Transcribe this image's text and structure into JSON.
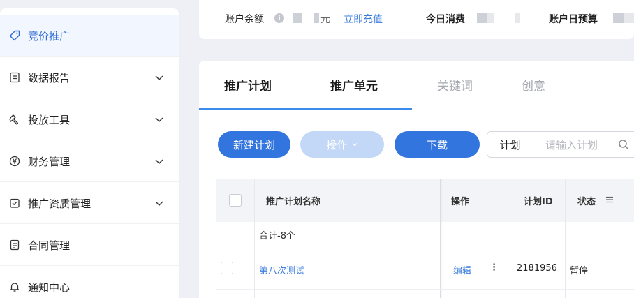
{
  "sidebar": {
    "items": [
      {
        "label": "竞价推广",
        "icon": "tag-icon",
        "expandable": false,
        "active": true
      },
      {
        "label": "数据报告",
        "icon": "report-icon",
        "expandable": true
      },
      {
        "label": "投放工具",
        "icon": "tools-icon",
        "expandable": true
      },
      {
        "label": "财务管理",
        "icon": "yuan-icon",
        "expandable": true
      },
      {
        "label": "推广资质管理",
        "icon": "certificate-icon",
        "expandable": true
      },
      {
        "label": "合同管理",
        "icon": "contract-icon",
        "expandable": false
      },
      {
        "label": "通知中心",
        "icon": "bell-icon",
        "expandable": false
      }
    ]
  },
  "topbar": {
    "balance_label": "账户余额",
    "balance_unit": "元",
    "recharge_link": "立即充值",
    "today_spend_label": "今日消费",
    "daily_budget_label": "账户日预算"
  },
  "tabs": [
    {
      "label": "推广计划",
      "active": true
    },
    {
      "label": "推广单元",
      "active": false
    },
    {
      "label": "关键词",
      "active": false
    },
    {
      "label": "创意",
      "active": false
    }
  ],
  "toolbar": {
    "new_plan": "新建计划",
    "operate": "操作",
    "download": "下载",
    "filter_select": "计划",
    "search_placeholder": "请输入计划"
  },
  "table": {
    "columns": [
      "推广计划名称",
      "操作",
      "计划ID",
      "状态"
    ],
    "summary": "合计-8个",
    "rows": [
      {
        "name": "第八次测试",
        "edit": "编辑",
        "more": "⋮",
        "id": "2181956",
        "status": "暂停"
      }
    ]
  },
  "colors": {
    "accent": "#3275de",
    "link": "#3b7ddd",
    "disabled_button": "#c3d7f6",
    "tab_underline": "#3b8bea"
  }
}
